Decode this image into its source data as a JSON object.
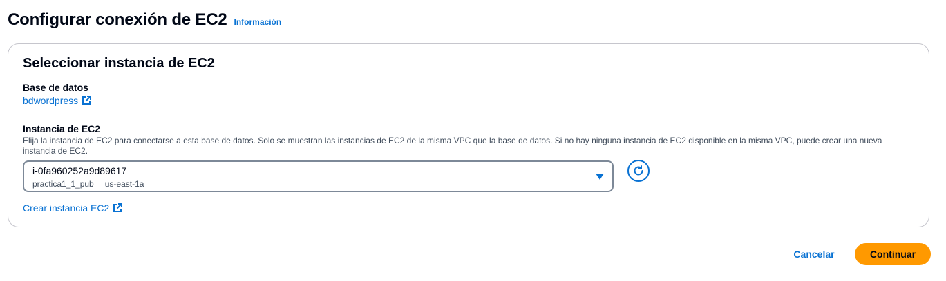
{
  "header": {
    "title": "Configurar conexión de EC2",
    "info_link": "Información"
  },
  "section": {
    "title": "Seleccionar instancia de EC2",
    "database": {
      "label": "Base de datos",
      "link": "bdwordpress"
    },
    "ec2": {
      "label": "Instancia de EC2",
      "description": "Elija la instancia de EC2 para conectarse a esta base de datos. Solo se muestran las instancias de EC2 de la misma VPC que la base de datos. Si no hay ninguna instancia de EC2 disponible en la misma VPC, puede crear una nueva instancia de EC2.",
      "selected_value": "i-0fa960252a9d89617",
      "tags": [
        "practica1_1_pub",
        "us-east-1a"
      ]
    },
    "create_link": "Crear instancia EC2"
  },
  "footer": {
    "cancel_label": "Cancelar",
    "continue_label": "Continuar"
  },
  "colors": {
    "link": "#0972d3",
    "primary_button": "#ff9900",
    "text": "#000716",
    "secondary_text": "#414d5c",
    "border": "#c6c6cd"
  },
  "icons": {
    "external_link": "external-link-icon",
    "dropdown": "caret-down-icon",
    "refresh": "refresh-icon"
  }
}
